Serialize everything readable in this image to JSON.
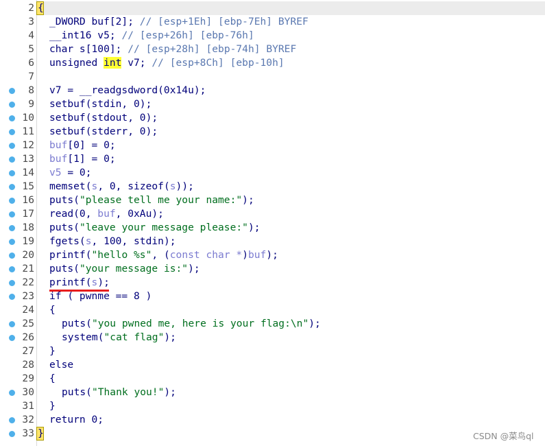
{
  "editor": {
    "lines": [
      {
        "n": "2",
        "bp": false,
        "indent": 0,
        "parts": []
      },
      {
        "n": "3",
        "bp": false,
        "indent": 0,
        "parts": [
          {
            "t": "_DWORD buf[2]; "
          },
          {
            "t": "// [esp+1Eh] [ebp-7Eh] BYREF",
            "c": "cm"
          }
        ]
      },
      {
        "n": "4",
        "bp": false,
        "indent": 0,
        "parts": [
          {
            "t": "__int16 v5; "
          },
          {
            "t": "// [esp+26h] [ebp-76h]",
            "c": "cm"
          }
        ]
      },
      {
        "n": "5",
        "bp": false,
        "indent": 0,
        "parts": [
          {
            "t": "char s[100]; "
          },
          {
            "t": "// [esp+28h] [ebp-74h] BYREF",
            "c": "cm"
          }
        ]
      },
      {
        "n": "6",
        "bp": false,
        "indent": 0,
        "parts": [
          {
            "t": "unsigned "
          },
          {
            "t": "int",
            "c": "kwhl"
          },
          {
            "t": " v7; "
          },
          {
            "t": "// [esp+8Ch] [ebp-10h]",
            "c": "cm"
          }
        ]
      },
      {
        "n": "7",
        "bp": false,
        "indent": 0,
        "parts": []
      },
      {
        "n": "8",
        "bp": true,
        "indent": 0,
        "parts": [
          {
            "t": "v7 = __readgsdword(0x14u);"
          }
        ]
      },
      {
        "n": "9",
        "bp": true,
        "indent": 0,
        "parts": [
          {
            "t": "setbuf(stdin, 0);"
          }
        ]
      },
      {
        "n": "10",
        "bp": true,
        "indent": 0,
        "parts": [
          {
            "t": "setbuf(stdout, 0);"
          }
        ]
      },
      {
        "n": "11",
        "bp": true,
        "indent": 0,
        "parts": [
          {
            "t": "setbuf(stderr, 0);"
          }
        ]
      },
      {
        "n": "12",
        "bp": true,
        "indent": 0,
        "parts": [
          {
            "t": "buf",
            "c": "var"
          },
          {
            "t": "[0] = 0;"
          }
        ]
      },
      {
        "n": "13",
        "bp": true,
        "indent": 0,
        "parts": [
          {
            "t": "buf",
            "c": "var"
          },
          {
            "t": "[1] = 0;"
          }
        ]
      },
      {
        "n": "14",
        "bp": true,
        "indent": 0,
        "parts": [
          {
            "t": "v5",
            "c": "var"
          },
          {
            "t": " = 0;"
          }
        ]
      },
      {
        "n": "15",
        "bp": true,
        "indent": 0,
        "parts": [
          {
            "t": "memset("
          },
          {
            "t": "s",
            "c": "var"
          },
          {
            "t": ", 0, sizeof("
          },
          {
            "t": "s",
            "c": "var"
          },
          {
            "t": "));"
          }
        ]
      },
      {
        "n": "16",
        "bp": true,
        "indent": 0,
        "parts": [
          {
            "t": "puts("
          },
          {
            "t": "\"please tell me your name:\"",
            "c": "str"
          },
          {
            "t": ");"
          }
        ]
      },
      {
        "n": "17",
        "bp": true,
        "indent": 0,
        "parts": [
          {
            "t": "read(0, "
          },
          {
            "t": "buf",
            "c": "var"
          },
          {
            "t": ", 0xAu);"
          }
        ]
      },
      {
        "n": "18",
        "bp": true,
        "indent": 0,
        "parts": [
          {
            "t": "puts("
          },
          {
            "t": "\"leave your message please:\"",
            "c": "str"
          },
          {
            "t": ");"
          }
        ]
      },
      {
        "n": "19",
        "bp": true,
        "indent": 0,
        "parts": [
          {
            "t": "fgets("
          },
          {
            "t": "s",
            "c": "var"
          },
          {
            "t": ", 100, stdin);"
          }
        ]
      },
      {
        "n": "20",
        "bp": true,
        "indent": 0,
        "parts": [
          {
            "t": "printf("
          },
          {
            "t": "\"hello %s\"",
            "c": "str"
          },
          {
            "t": ", ("
          },
          {
            "t": "const char *",
            "c": "var"
          },
          {
            "t": ")"
          },
          {
            "t": "buf",
            "c": "var"
          },
          {
            "t": ");"
          }
        ]
      },
      {
        "n": "21",
        "bp": true,
        "indent": 0,
        "parts": [
          {
            "t": "puts("
          },
          {
            "t": "\"your message is:\"",
            "c": "str"
          },
          {
            "t": ");"
          }
        ]
      },
      {
        "n": "22",
        "bp": true,
        "indent": 0,
        "parts": [
          {
            "t": "printf("
          },
          {
            "t": "s",
            "c": "var"
          },
          {
            "t": ");"
          }
        ]
      },
      {
        "n": "23",
        "bp": true,
        "indent": 0,
        "parts": [
          {
            "t": "if ( pwnme == 8 )"
          }
        ]
      },
      {
        "n": "24",
        "bp": false,
        "indent": 0,
        "parts": [
          {
            "t": "{"
          }
        ]
      },
      {
        "n": "25",
        "bp": true,
        "indent": 1,
        "parts": [
          {
            "t": "puts("
          },
          {
            "t": "\"you pwned me, here is your flag:\\n\"",
            "c": "str"
          },
          {
            "t": ");"
          }
        ]
      },
      {
        "n": "26",
        "bp": true,
        "indent": 1,
        "parts": [
          {
            "t": "system("
          },
          {
            "t": "\"cat flag\"",
            "c": "str"
          },
          {
            "t": ");"
          }
        ]
      },
      {
        "n": "27",
        "bp": false,
        "indent": 0,
        "parts": [
          {
            "t": "}"
          }
        ]
      },
      {
        "n": "28",
        "bp": false,
        "indent": 0,
        "parts": [
          {
            "t": "else"
          }
        ]
      },
      {
        "n": "29",
        "bp": false,
        "indent": 0,
        "parts": [
          {
            "t": "{"
          }
        ]
      },
      {
        "n": "30",
        "bp": true,
        "indent": 1,
        "parts": [
          {
            "t": "puts("
          },
          {
            "t": "\"Thank you!\"",
            "c": "str"
          },
          {
            "t": ");"
          }
        ]
      },
      {
        "n": "31",
        "bp": false,
        "indent": 0,
        "parts": [
          {
            "t": "}"
          }
        ]
      },
      {
        "n": "32",
        "bp": true,
        "indent": 0,
        "parts": [
          {
            "t": "return 0;"
          }
        ]
      },
      {
        "n": "33",
        "bp": true,
        "indent": 0,
        "parts": []
      }
    ],
    "open_brace": "{",
    "close_brace": "}"
  },
  "watermark": "CSDN @菜鸟ql",
  "colors": {
    "breakpoint": "#4fb0ea",
    "annotation_underline": "#e81c1c",
    "keyword_highlight": "#ffff33"
  }
}
